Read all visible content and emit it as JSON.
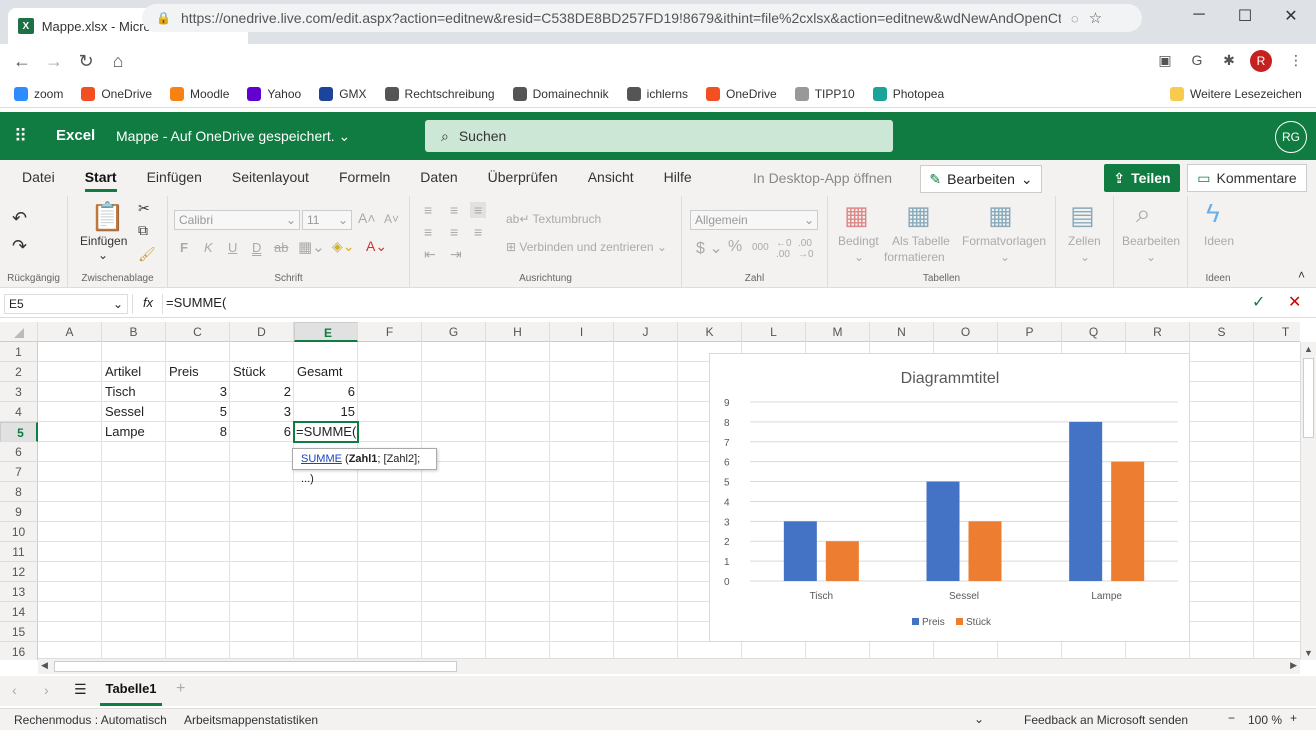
{
  "browser": {
    "tab_title": "Mappe.xlsx - Microsoft Excel Onl",
    "url": "https://onedrive.live.com/edit.aspx?action=editnew&resid=C538DE8BD257FD19!8679&ithint=file%2cxlsx&action=editnew&wdNewAndOpenCt...",
    "profile_initial": "R",
    "bookmarks": [
      {
        "label": "zoom",
        "color": "#2d8cff"
      },
      {
        "label": "OneDrive",
        "color": "#f25022"
      },
      {
        "label": "Moodle",
        "color": "#f98012"
      },
      {
        "label": "Yahoo",
        "color": "#6001d2"
      },
      {
        "label": "GMX",
        "color": "#1c449b"
      },
      {
        "label": "Rechtschreibung",
        "color": "#555555"
      },
      {
        "label": "Domainechnik",
        "color": "#555555"
      },
      {
        "label": "ichlerns",
        "color": "#555555"
      },
      {
        "label": "OneDrive",
        "color": "#f25022"
      },
      {
        "label": "TIPP10",
        "color": "#999999"
      },
      {
        "label": "Photopea",
        "color": "#18a497"
      }
    ],
    "other_bookmarks": "Weitere Lesezeichen"
  },
  "excel": {
    "app_name": "Excel",
    "doc_status": "Mappe  -  Auf OneDrive gespeichert.",
    "search_placeholder": "Suchen",
    "user_initials": "RG",
    "tabs": [
      "Datei",
      "Start",
      "Einfügen",
      "Seitenlayout",
      "Formeln",
      "Daten",
      "Überprüfen",
      "Ansicht",
      "Hilfe"
    ],
    "desktop_app": "In Desktop-App öffnen",
    "edit_button": "Bearbeiten",
    "share_button": "Teilen",
    "comment_button": "Kommentare",
    "accent": "#107c41"
  },
  "ribbon": {
    "undo_group": "Rückgängig",
    "paste": "Einfügen",
    "clipboard_group": "Zwischenablage",
    "font_name": "Calibri",
    "font_size": "11",
    "font_group": "Schrift",
    "bold": "F",
    "italic": "K",
    "underline": "U",
    "double_underline": "D",
    "strike": "ab",
    "wrap_text": "Textumbruch",
    "merge_center": "Verbinden und zentrieren",
    "align_group": "Ausrichtung",
    "number_format": "Allgemein",
    "number_group": "Zahl",
    "cond_format": "Bedingt",
    "format_table_1": "Als Tabelle",
    "format_table_2": "formatieren",
    "cell_styles": "Formatvorlagen",
    "tables_group": "Tabellen",
    "cells": "Zellen",
    "edit": "Bearbeiten",
    "ideas": "Ideen",
    "ideas_group": "Ideen"
  },
  "formula_bar": {
    "name_box": "E5",
    "fx": "fx",
    "formula": "=SUMME("
  },
  "sheet": {
    "columns": [
      "A",
      "B",
      "C",
      "D",
      "E",
      "F",
      "G",
      "H",
      "I",
      "J",
      "K",
      "L",
      "M",
      "N",
      "O",
      "P",
      "Q",
      "R",
      "S",
      "T"
    ],
    "rows": [
      "1",
      "2",
      "3",
      "4",
      "5",
      "6",
      "7",
      "8",
      "9",
      "10",
      "11",
      "12",
      "13",
      "14",
      "15",
      "16"
    ],
    "table": {
      "header": [
        "Artikel",
        "Preis",
        "Stück",
        "Gesamt"
      ],
      "rows": [
        [
          "Tisch",
          "3",
          "2",
          "6"
        ],
        [
          "Sessel",
          "5",
          "3",
          "15"
        ],
        [
          "Lampe",
          "8",
          "6",
          ""
        ]
      ]
    },
    "active_cell_text": "=SUMME(",
    "tooltip_func": "SUMME",
    "tooltip_args": " (Zahl1; [Zahl2]; ...)",
    "tooltip_bold": "Zahl1"
  },
  "chart_data": {
    "type": "bar",
    "title": "Diagrammtitel",
    "categories": [
      "Tisch",
      "Sessel",
      "Lampe"
    ],
    "series": [
      {
        "name": "Preis",
        "values": [
          3,
          5,
          8
        ],
        "color": "#4472c4"
      },
      {
        "name": "Stück",
        "values": [
          2,
          3,
          6
        ],
        "color": "#ed7d31"
      }
    ],
    "ylim": [
      0,
      9
    ],
    "yticks": [
      "0",
      "1",
      "2",
      "3",
      "4",
      "5",
      "6",
      "7",
      "8",
      "9"
    ],
    "grid": true,
    "legend": "bottom"
  },
  "sheets": {
    "active_tab": "Tabelle1"
  },
  "status": {
    "calc_mode": "Rechenmodus : Automatisch",
    "stats": "Arbeitsmappenstatistiken",
    "feedback": "Feedback an Microsoft senden",
    "zoom": "100 %"
  }
}
